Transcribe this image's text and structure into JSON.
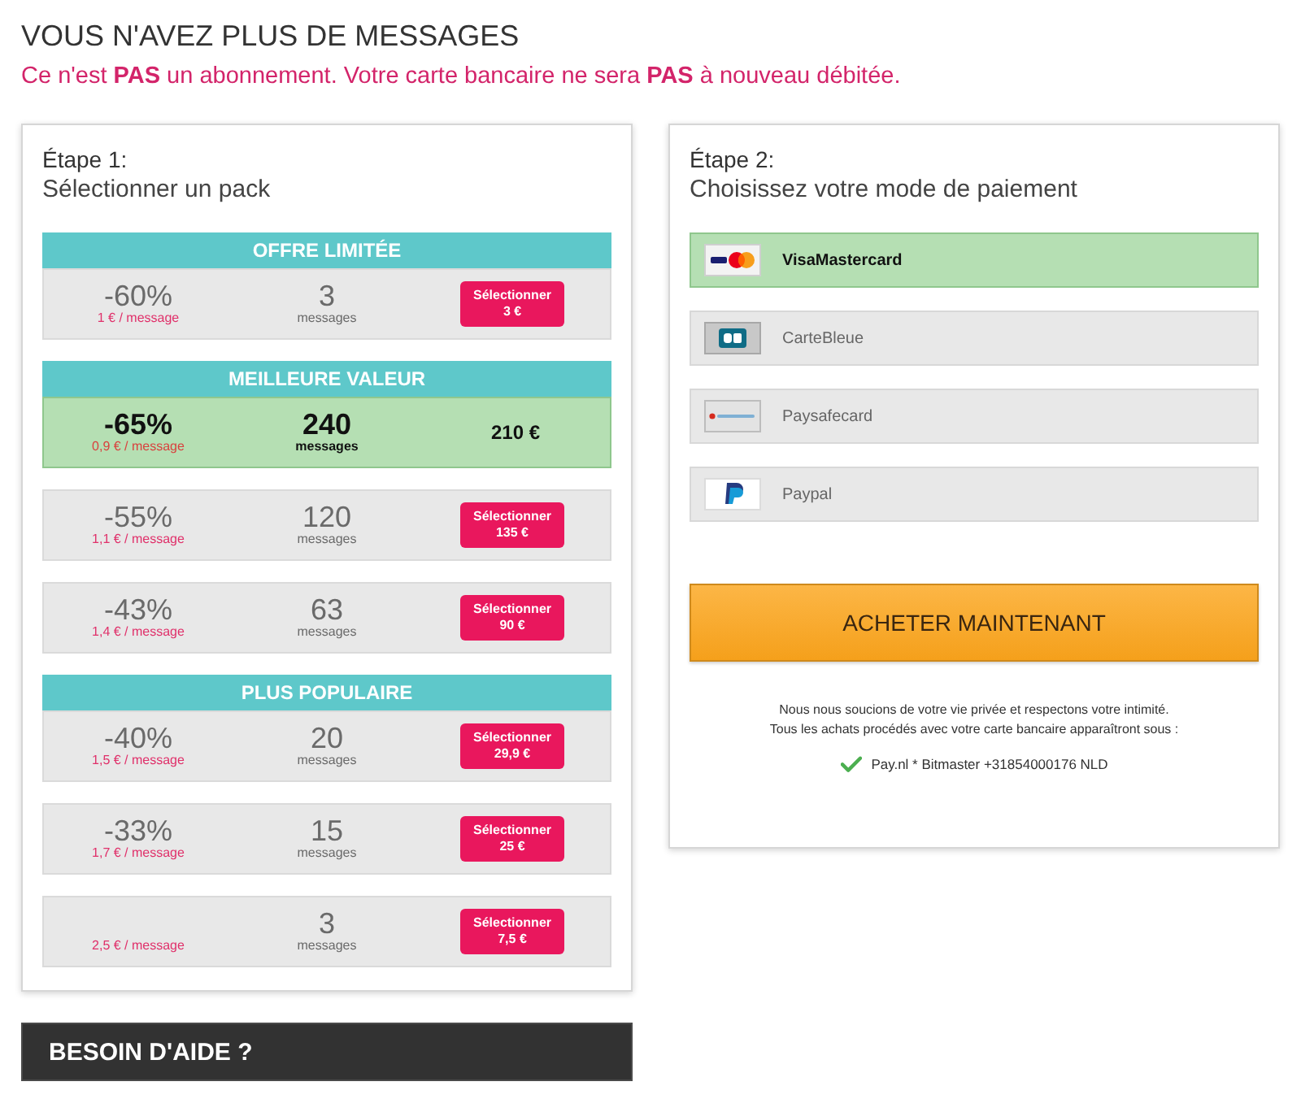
{
  "header": {
    "title": "VOUS N'AVEZ PLUS DE MESSAGES",
    "notice": "Ce n'est **PAS** un abonnement. Votre carte bancaire ne sera **PAS** à nouveau débitée."
  },
  "pack_step": {
    "step": "Étape 1:",
    "title": "Sélectionner un pack",
    "packs": [
      {
        "banner": "OFFRE LIMITÉE",
        "discount": "-60%",
        "unit_price": "1 € / message",
        "count": "3",
        "count_label": "messages",
        "selected": false,
        "button": "Sélectionner",
        "price": "3 €"
      },
      {
        "banner": "MEILLEURE VALEUR",
        "discount": "-65%",
        "unit_price": "0,9 € / message",
        "count": "240",
        "count_label": "messages",
        "selected": true,
        "price": "210 €"
      },
      {
        "discount": "-55%",
        "unit_price": "1,1 € / message",
        "count": "120",
        "count_label": "messages",
        "selected": false,
        "button": "Sélectionner",
        "price": "135 €"
      },
      {
        "discount": "-43%",
        "unit_price": "1,4 € / message",
        "count": "63",
        "count_label": "messages",
        "selected": false,
        "button": "Sélectionner",
        "price": "90 €"
      },
      {
        "banner": "PLUS POPULAIRE",
        "discount": "-40%",
        "unit_price": "1,5 € / message",
        "count": "20",
        "count_label": "messages",
        "selected": false,
        "button": "Sélectionner",
        "price": "29,9 €"
      },
      {
        "discount": "-33%",
        "unit_price": "1,7 € / message",
        "count": "15",
        "count_label": "messages",
        "selected": false,
        "button": "Sélectionner",
        "price": "25 €"
      },
      {
        "unit_price": "2,5 € / message",
        "count": "3",
        "count_label": "messages",
        "selected": false,
        "button": "Sélectionner",
        "price": "7,5 €"
      }
    ]
  },
  "payment_step": {
    "step": "Étape 2:",
    "title": "Choisissez votre mode de paiement",
    "methods": [
      {
        "name": "VisaMastercard",
        "kind": "visa_mastercard",
        "selected": true
      },
      {
        "name": "CarteBleue",
        "kind": "cb",
        "selected": false
      },
      {
        "name": "Paysafecard",
        "kind": "paysafecard",
        "selected": false
      },
      {
        "name": "Paypal",
        "kind": "paypal",
        "selected": false
      }
    ],
    "buy_button": "ACHETER MAINTENANT",
    "privacy_lines": [
      "Nous nous soucions de votre vie privée et respectons votre intimité.",
      "Tous les achats procédés avec votre carte bancaire apparaîtront sous :"
    ],
    "descriptor": "Pay.nl * Bitmaster +31854000176 NLD"
  },
  "help_bar": {
    "title": "BESOIN D'AIDE ?"
  }
}
